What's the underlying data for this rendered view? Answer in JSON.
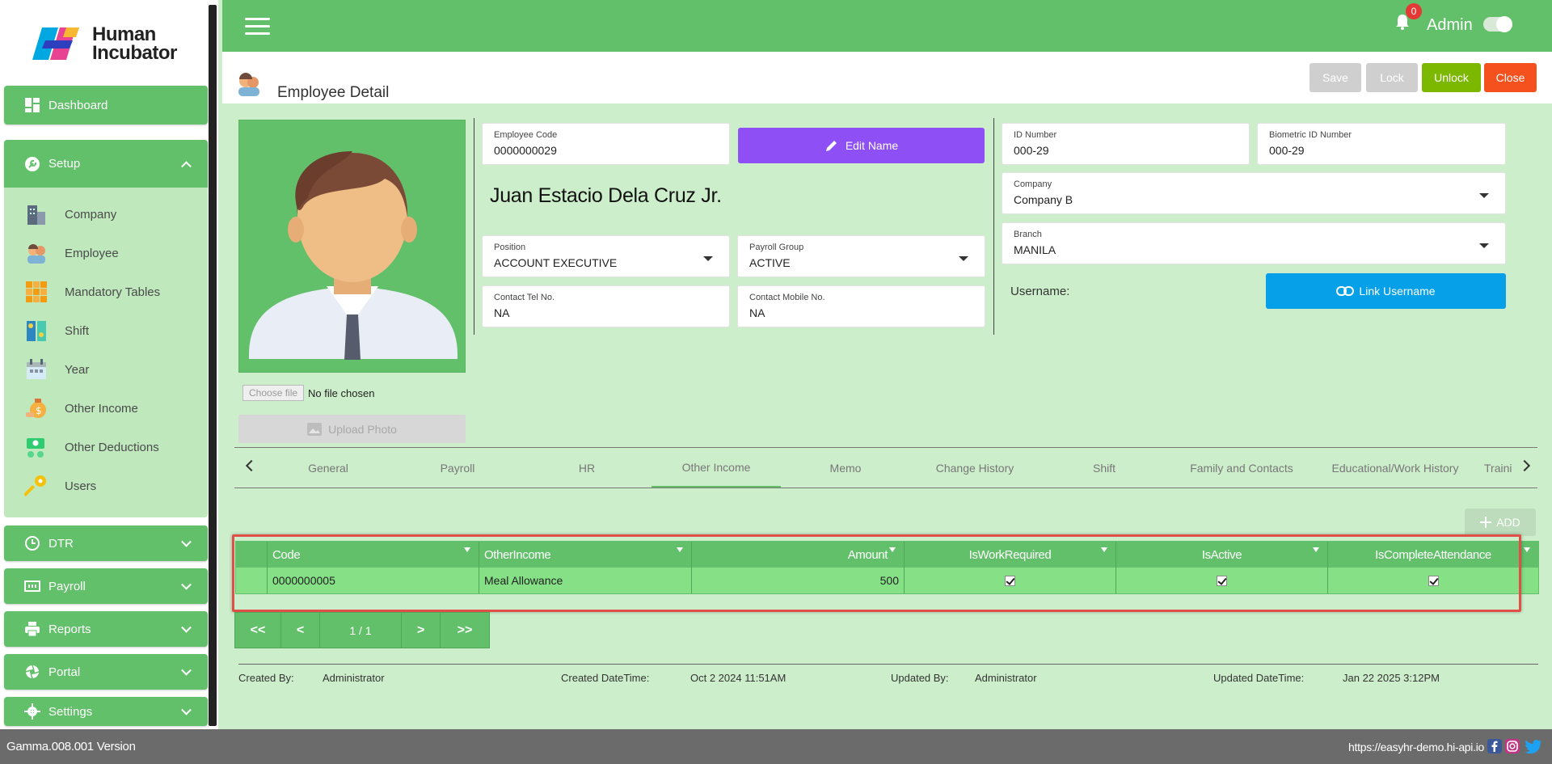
{
  "brand": {
    "line1": "Human",
    "line2": "Incubator"
  },
  "sidebar": {
    "dashboard": "Dashboard",
    "setup": "Setup",
    "setup_items": [
      "Company",
      "Employee",
      "Mandatory Tables",
      "Shift",
      "Year",
      "Other Income",
      "Other Deductions",
      "Users"
    ],
    "dtr": "DTR",
    "payroll": "Payroll",
    "reports": "Reports",
    "portal": "Portal",
    "settings": "Settings"
  },
  "topbar": {
    "notification_count": "0",
    "user": "Admin"
  },
  "page": {
    "title": "Employee Detail",
    "buttons": {
      "save": "Save",
      "lock": "Lock",
      "unlock": "Unlock",
      "close": "Close"
    }
  },
  "photo": {
    "choose_file": "Choose file",
    "no_file": "No file chosen",
    "upload": "Upload Photo"
  },
  "employee": {
    "code_label": "Employee Code",
    "code": "0000000029",
    "edit_name": "Edit Name",
    "full_name": "Juan Estacio  Dela Cruz Jr.",
    "position_label": "Position",
    "position": "ACCOUNT EXECUTIVE",
    "payroll_group_label": "Payroll Group",
    "payroll_group": "ACTIVE",
    "tel_label": "Contact Tel No.",
    "tel": "NA",
    "mobile_label": "Contact Mobile No.",
    "mobile": "NA",
    "id_label": "ID Number",
    "id": "000-29",
    "bio_label": "Biometric ID Number",
    "bio": "000-29",
    "company_label": "Company",
    "company": "Company B",
    "branch_label": "Branch",
    "branch": "MANILA",
    "username_label": "Username:",
    "link_username": "Link Username"
  },
  "tabs": [
    "General",
    "Payroll",
    "HR",
    "Other Income",
    "Memo",
    "Change History",
    "Shift",
    "Family and Contacts",
    "Educational/Work History",
    "Traini"
  ],
  "grid": {
    "add": "ADD",
    "columns": [
      "Code",
      "OtherIncome",
      "Amount",
      "IsWorkRequired",
      "IsActive",
      "IsCompleteAttendance"
    ],
    "rows": [
      {
        "code": "0000000005",
        "other_income": "Meal Allowance",
        "amount": "500",
        "is_work_required": true,
        "is_active": true,
        "is_complete_attendance": true
      }
    ]
  },
  "pager": {
    "first": "<<",
    "prev": "<",
    "info": "1 / 1",
    "next": ">",
    "last": ">>"
  },
  "audit": {
    "created_by_label": "Created By:",
    "created_by": "Administrator",
    "created_dt_label": "Created DateTime:",
    "created_dt": "Oct 2 2024 11:51AM",
    "updated_by_label": "Updated By:",
    "updated_by": "Administrator",
    "updated_dt_label": "Updated DateTime:",
    "updated_dt": "Jan 22 2025 3:12PM"
  },
  "bottom": {
    "version": "Gamma.008.001 Version",
    "url": "https://easyhr-demo.hi-api.io"
  },
  "colors": {
    "primary_green": "#63c06a",
    "purple": "#8e4ff5",
    "blue": "#06a0e8",
    "unlock": "#7cb800",
    "close": "#f4511e"
  }
}
